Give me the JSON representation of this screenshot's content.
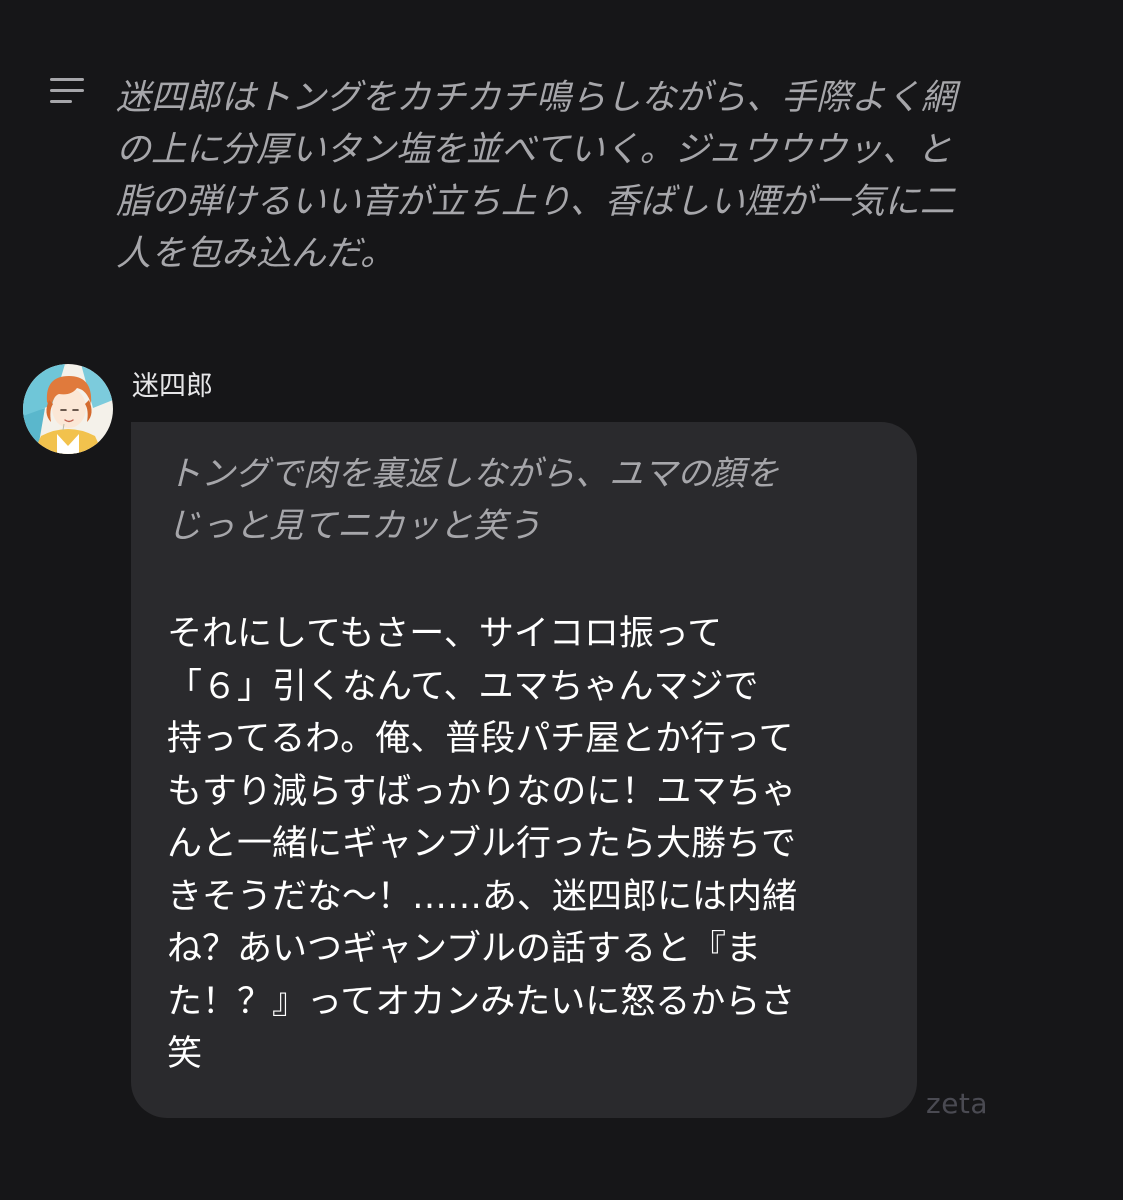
{
  "narration": {
    "icon": "text-lines-icon",
    "text": "迷四郎はトングをカチカチ鳴らしながら、手際よく網\nの上に分厚いタン塩を並べていく。ジュウウウッ、と\n脂の弾けるいい音が立ち上り、香ばしい煙が一気に二\n人を包み込んだ。"
  },
  "message": {
    "sender_name": "迷四郎",
    "avatar_icon": "character-avatar-icon",
    "action_text": "トングで肉を裏返しながら、ユマの顔を\nじっと見てニカッと笑う",
    "speech_text": "それにしてもさー、サイコロ振って\n「６」引くなんて、ユマちゃんマジで\n持ってるわ。俺、普段パチ屋とか行って\nもすり減らすばっかりなのに！ユマちゃ\nんと一緒にギャンブル行ったら大勝ちで\nきそうだな〜！……あ、迷四郎には内緒\nね？あいつギャンブルの話すると『ま\nた！？』ってオカンみたいに怒るからさ\n笑"
  },
  "watermark": "zeta",
  "colors": {
    "background": "#161618",
    "bubble": "#2a2a2d",
    "narration_text": "#a6a6aa",
    "speech_text": "#ffffff",
    "watermark": "#4a4a52"
  }
}
